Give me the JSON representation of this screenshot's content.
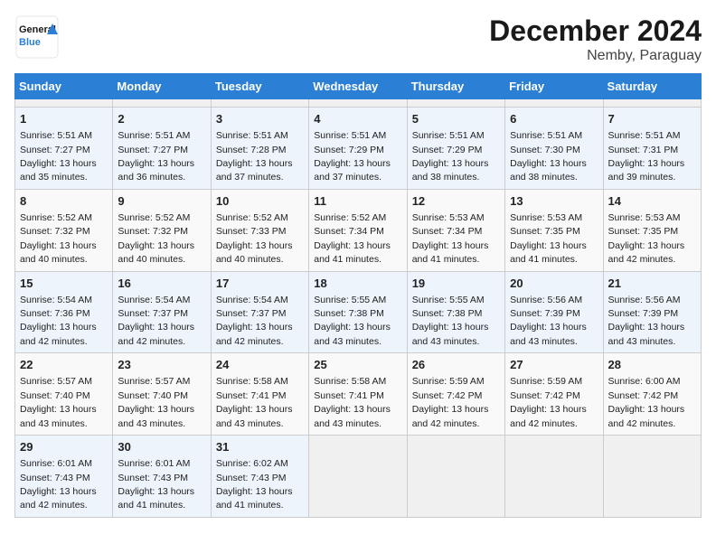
{
  "header": {
    "logo_line1": "General",
    "logo_line2": "Blue",
    "title": "December 2024",
    "subtitle": "Nemby, Paraguay"
  },
  "calendar": {
    "days_of_week": [
      "Sunday",
      "Monday",
      "Tuesday",
      "Wednesday",
      "Thursday",
      "Friday",
      "Saturday"
    ],
    "weeks": [
      [
        null,
        null,
        null,
        null,
        null,
        null,
        null
      ],
      [
        {
          "day": 1,
          "sunrise": "5:51 AM",
          "sunset": "7:27 PM",
          "daylight": "13 hours and 35 minutes."
        },
        {
          "day": 2,
          "sunrise": "5:51 AM",
          "sunset": "7:27 PM",
          "daylight": "13 hours and 36 minutes."
        },
        {
          "day": 3,
          "sunrise": "5:51 AM",
          "sunset": "7:28 PM",
          "daylight": "13 hours and 37 minutes."
        },
        {
          "day": 4,
          "sunrise": "5:51 AM",
          "sunset": "7:29 PM",
          "daylight": "13 hours and 37 minutes."
        },
        {
          "day": 5,
          "sunrise": "5:51 AM",
          "sunset": "7:29 PM",
          "daylight": "13 hours and 38 minutes."
        },
        {
          "day": 6,
          "sunrise": "5:51 AM",
          "sunset": "7:30 PM",
          "daylight": "13 hours and 38 minutes."
        },
        {
          "day": 7,
          "sunrise": "5:51 AM",
          "sunset": "7:31 PM",
          "daylight": "13 hours and 39 minutes."
        }
      ],
      [
        {
          "day": 8,
          "sunrise": "5:52 AM",
          "sunset": "7:32 PM",
          "daylight": "13 hours and 40 minutes."
        },
        {
          "day": 9,
          "sunrise": "5:52 AM",
          "sunset": "7:32 PM",
          "daylight": "13 hours and 40 minutes."
        },
        {
          "day": 10,
          "sunrise": "5:52 AM",
          "sunset": "7:33 PM",
          "daylight": "13 hours and 40 minutes."
        },
        {
          "day": 11,
          "sunrise": "5:52 AM",
          "sunset": "7:34 PM",
          "daylight": "13 hours and 41 minutes."
        },
        {
          "day": 12,
          "sunrise": "5:53 AM",
          "sunset": "7:34 PM",
          "daylight": "13 hours and 41 minutes."
        },
        {
          "day": 13,
          "sunrise": "5:53 AM",
          "sunset": "7:35 PM",
          "daylight": "13 hours and 41 minutes."
        },
        {
          "day": 14,
          "sunrise": "5:53 AM",
          "sunset": "7:35 PM",
          "daylight": "13 hours and 42 minutes."
        }
      ],
      [
        {
          "day": 15,
          "sunrise": "5:54 AM",
          "sunset": "7:36 PM",
          "daylight": "13 hours and 42 minutes."
        },
        {
          "day": 16,
          "sunrise": "5:54 AM",
          "sunset": "7:37 PM",
          "daylight": "13 hours and 42 minutes."
        },
        {
          "day": 17,
          "sunrise": "5:54 AM",
          "sunset": "7:37 PM",
          "daylight": "13 hours and 42 minutes."
        },
        {
          "day": 18,
          "sunrise": "5:55 AM",
          "sunset": "7:38 PM",
          "daylight": "13 hours and 43 minutes."
        },
        {
          "day": 19,
          "sunrise": "5:55 AM",
          "sunset": "7:38 PM",
          "daylight": "13 hours and 43 minutes."
        },
        {
          "day": 20,
          "sunrise": "5:56 AM",
          "sunset": "7:39 PM",
          "daylight": "13 hours and 43 minutes."
        },
        {
          "day": 21,
          "sunrise": "5:56 AM",
          "sunset": "7:39 PM",
          "daylight": "13 hours and 43 minutes."
        }
      ],
      [
        {
          "day": 22,
          "sunrise": "5:57 AM",
          "sunset": "7:40 PM",
          "daylight": "13 hours and 43 minutes."
        },
        {
          "day": 23,
          "sunrise": "5:57 AM",
          "sunset": "7:40 PM",
          "daylight": "13 hours and 43 minutes."
        },
        {
          "day": 24,
          "sunrise": "5:58 AM",
          "sunset": "7:41 PM",
          "daylight": "13 hours and 43 minutes."
        },
        {
          "day": 25,
          "sunrise": "5:58 AM",
          "sunset": "7:41 PM",
          "daylight": "13 hours and 43 minutes."
        },
        {
          "day": 26,
          "sunrise": "5:59 AM",
          "sunset": "7:42 PM",
          "daylight": "13 hours and 42 minutes."
        },
        {
          "day": 27,
          "sunrise": "5:59 AM",
          "sunset": "7:42 PM",
          "daylight": "13 hours and 42 minutes."
        },
        {
          "day": 28,
          "sunrise": "6:00 AM",
          "sunset": "7:42 PM",
          "daylight": "13 hours and 42 minutes."
        }
      ],
      [
        {
          "day": 29,
          "sunrise": "6:01 AM",
          "sunset": "7:43 PM",
          "daylight": "13 hours and 42 minutes."
        },
        {
          "day": 30,
          "sunrise": "6:01 AM",
          "sunset": "7:43 PM",
          "daylight": "13 hours and 41 minutes."
        },
        {
          "day": 31,
          "sunrise": "6:02 AM",
          "sunset": "7:43 PM",
          "daylight": "13 hours and 41 minutes."
        },
        null,
        null,
        null,
        null
      ]
    ]
  }
}
